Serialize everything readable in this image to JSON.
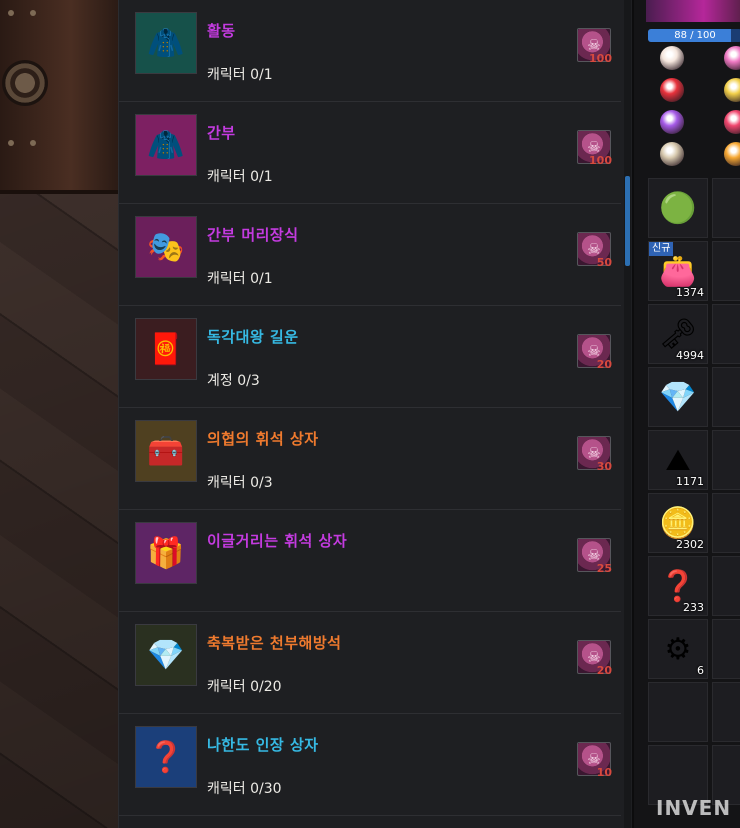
{
  "quests": [
    {
      "name": "활동",
      "name_color": "#c43be0",
      "count": "캐릭터 0/1",
      "reward": "100",
      "thumb_icon": "green-jacket-icon",
      "thumb_glyph": "🧥",
      "thumb_bg": "#16514a"
    },
    {
      "name": "간부",
      "name_color": "#c43be0",
      "count": "캐릭터 0/1",
      "reward": "100",
      "thumb_icon": "pink-jacket-icon",
      "thumb_glyph": "🧥",
      "thumb_bg": "#7d2062"
    },
    {
      "name": "간부 머리장식",
      "name_color": "#c43be0",
      "count": "캐릭터 0/1",
      "reward": "50",
      "thumb_icon": "pink-hood-icon",
      "thumb_glyph": "🎭",
      "thumb_bg": "#6b1f5b"
    },
    {
      "name": "독각대왕 길운",
      "name_color": "#36b9e3",
      "count": "계정 0/3",
      "reward": "20",
      "thumb_icon": "lucky-pouch-icon",
      "thumb_glyph": "🧧",
      "thumb_bg": "#3b1d20"
    },
    {
      "name": "의협의 휘석 상자",
      "name_color": "#ef7a2e",
      "count": "캐릭터 0/3",
      "reward": "30",
      "thumb_icon": "gold-chest-icon",
      "thumb_glyph": "🧰",
      "thumb_bg": "#4f4020"
    },
    {
      "name": "이글거리는 휘석 상자",
      "name_color": "#c43be0",
      "count": "",
      "reward": "25",
      "thumb_icon": "purple-box-icon",
      "thumb_glyph": "🎁",
      "thumb_bg": "#5e2565"
    },
    {
      "name": "축복받은 천부해방석",
      "name_color": "#ef7a2e",
      "count": "캐릭터 0/20",
      "reward": "20",
      "thumb_icon": "blessed-stone-icon",
      "thumb_glyph": "💎",
      "thumb_bg": "#2a3020"
    },
    {
      "name": "나한도 인장 상자",
      "name_color": "#36b9e3",
      "count": "캐릭터 0/30",
      "reward": "10",
      "thumb_icon": "seal-box-icon",
      "thumb_glyph": "❓",
      "thumb_bg": "#1b3f7a"
    }
  ],
  "inventory": {
    "hp_text": "88 / 100",
    "hp_fraction": 0.88,
    "gems": [
      {
        "icon": "white-gem-icon",
        "color": "#f5e6dd"
      },
      {
        "icon": "pink-gem-icon",
        "color": "#f07ac4"
      },
      {
        "icon": "red-gem-icon",
        "color": "#e8323c"
      },
      {
        "icon": "yellow-gem-icon",
        "color": "#f2d04a"
      },
      {
        "icon": "purple-gem-icon",
        "color": "#a65be8"
      },
      {
        "icon": "rose-gem-icon",
        "color": "#f0476e"
      },
      {
        "icon": "star-gem-icon",
        "color": "#d9cbb0"
      },
      {
        "icon": "amber-gem-icon",
        "color": "#f7a833"
      }
    ],
    "cells": [
      {
        "icon": "jade-orb-icon",
        "glyph": "🟢",
        "qty": "",
        "tag": ""
      },
      {
        "icon": "red-bag-icon",
        "glyph": "👛",
        "qty": "1374",
        "tag": "신규"
      },
      {
        "icon": "gold-key-icon",
        "glyph": "🗝",
        "qty": "4994",
        "tag": ""
      },
      {
        "icon": "blue-diamond-icon",
        "glyph": "💎",
        "qty": "",
        "tag": ""
      },
      {
        "icon": "gold-dust-icon",
        "glyph": "⛰",
        "qty": "1171",
        "tag": ""
      },
      {
        "icon": "gold-coin-icon",
        "glyph": "🪙",
        "qty": "2302",
        "tag": ""
      },
      {
        "icon": "mystery-box-icon",
        "glyph": "❓",
        "qty": "233",
        "tag": ""
      },
      {
        "icon": "silver-token-icon",
        "glyph": "⚙",
        "qty": "6",
        "tag": ""
      }
    ]
  },
  "watermark": "INVEN"
}
